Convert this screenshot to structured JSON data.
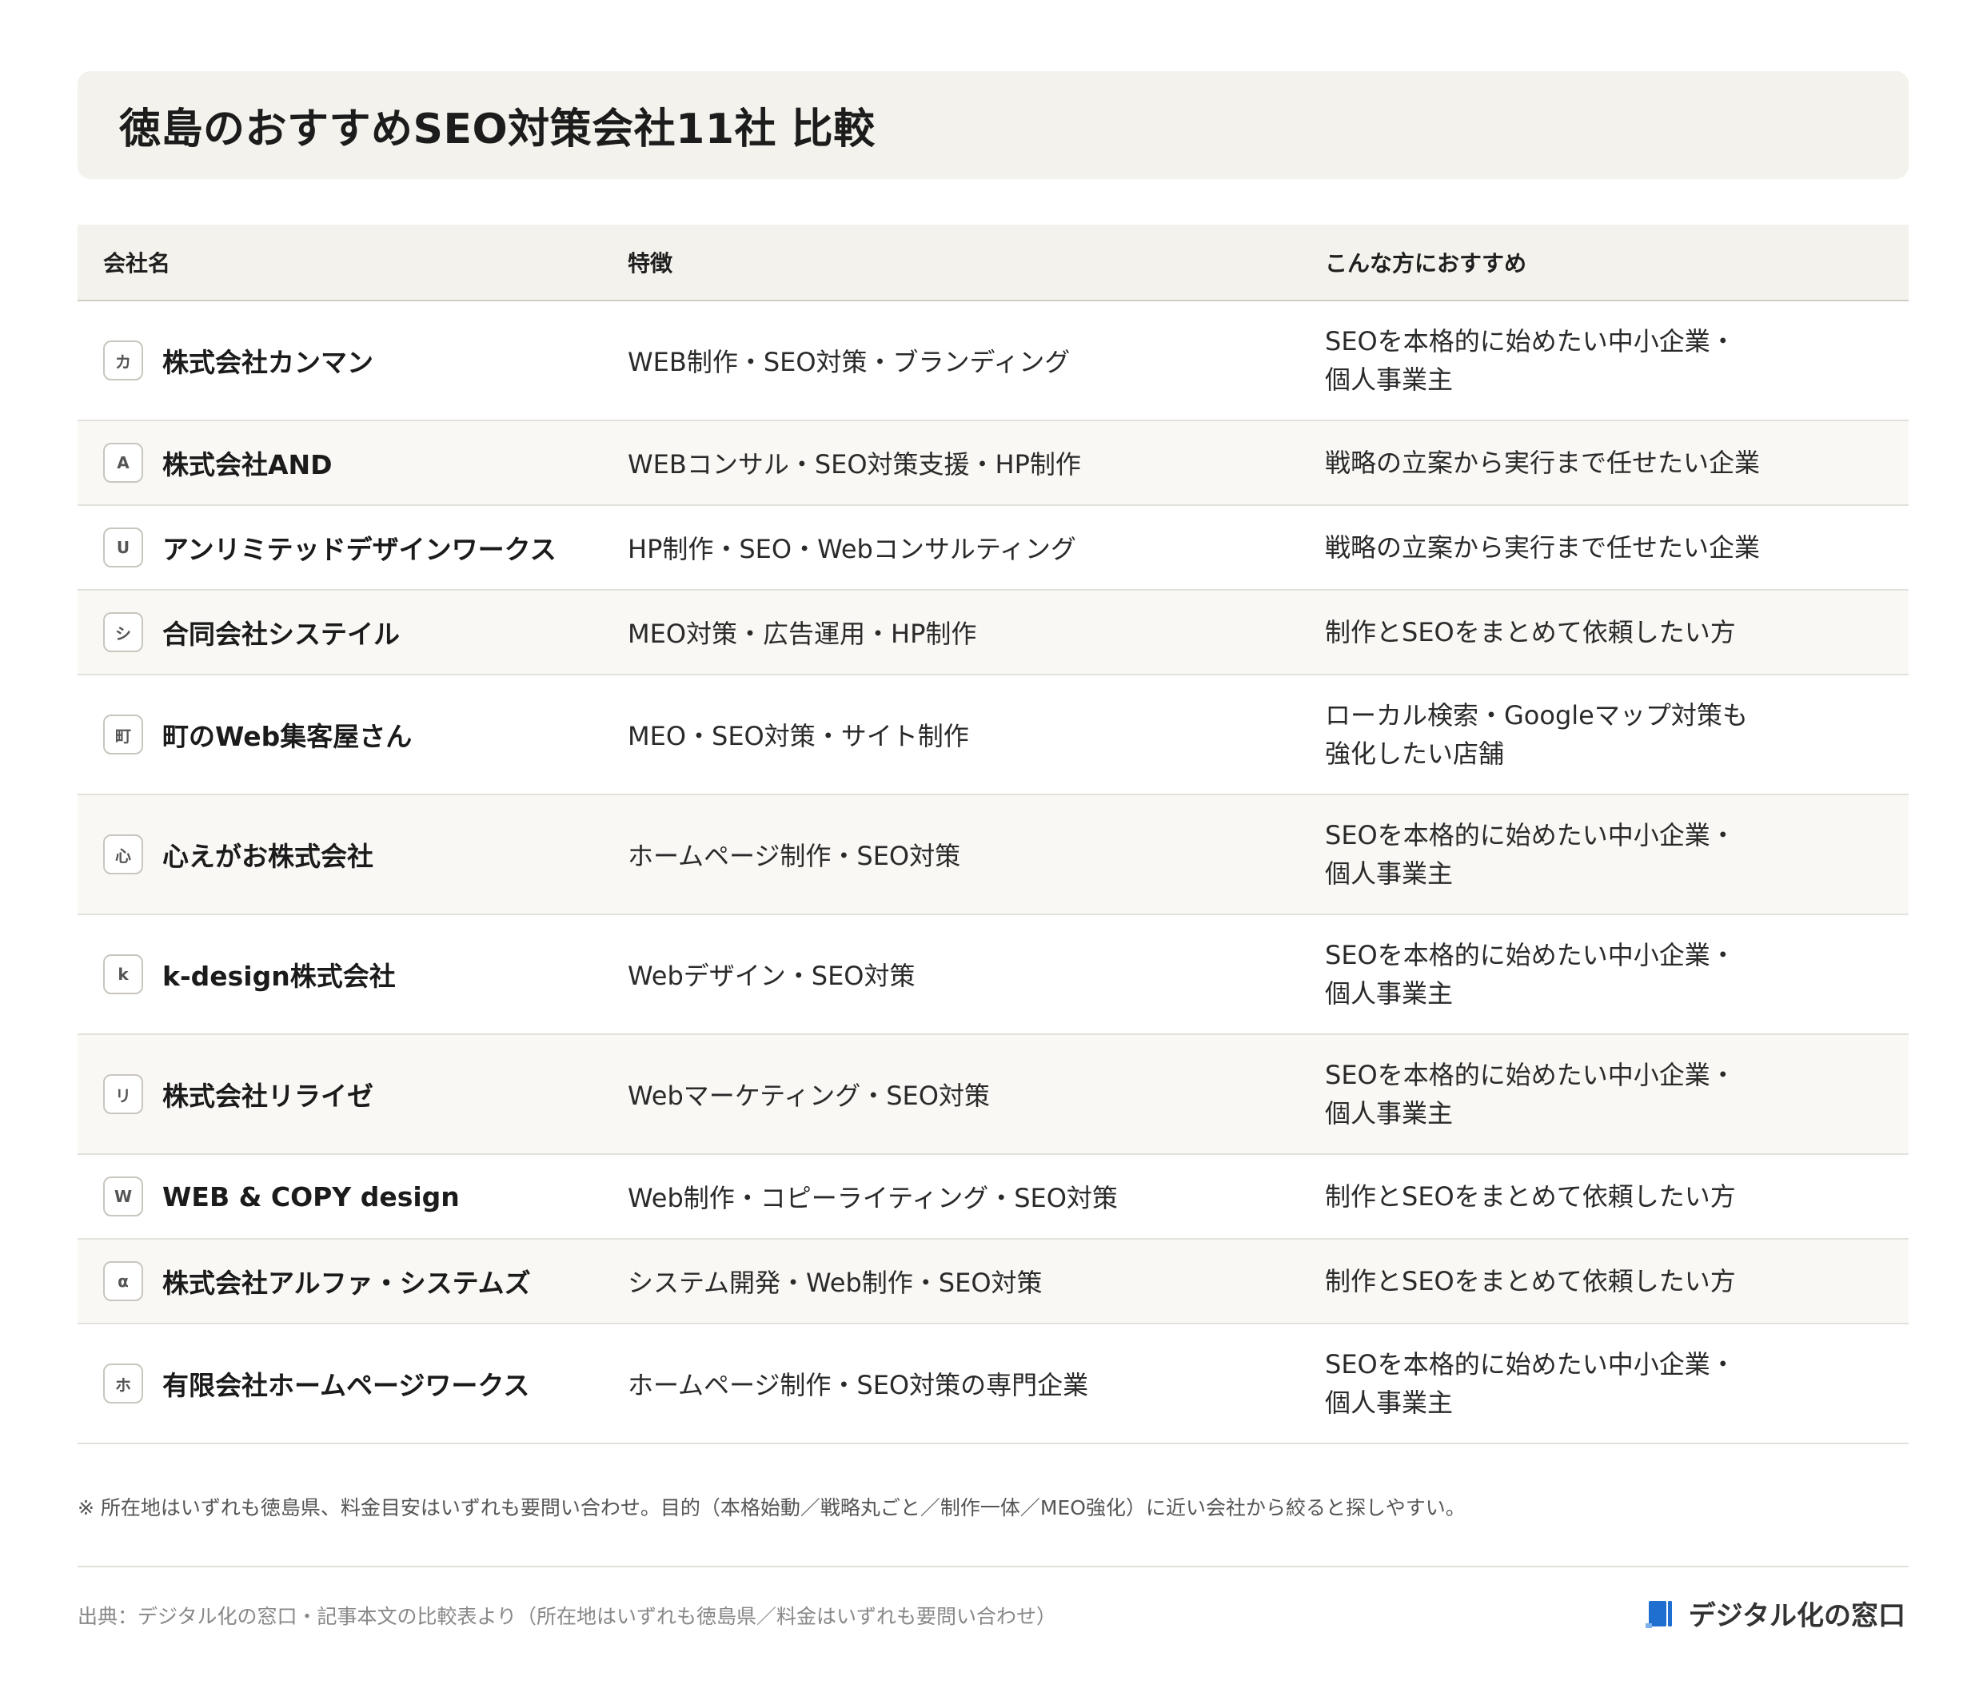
{
  "title": "徳島のおすすめSEO対策会社11社 比較",
  "table": {
    "headers": {
      "company": "会社名",
      "feature": "特徴",
      "recommended_for": "こんな方におすすめ"
    },
    "rows": [
      {
        "badge": "カ",
        "company": "株式会社カンマン",
        "feature": "WEB制作・SEO対策・ブランディング",
        "recommended_for": "SEOを本格的に始めたい中小企業・\n個人事業主"
      },
      {
        "badge": "A",
        "company": "株式会社AND",
        "feature": "WEBコンサル・SEO対策支援・HP制作",
        "recommended_for": "戦略の立案から実行まで任せたい企業"
      },
      {
        "badge": "U",
        "company": "アンリミテッドデザインワークス",
        "feature": "HP制作・SEO・Webコンサルティング",
        "recommended_for": "戦略の立案から実行まで任せたい企業"
      },
      {
        "badge": "シ",
        "company": "合同会社システイル",
        "feature": "MEO対策・広告運用・HP制作",
        "recommended_for": "制作とSEOをまとめて依頼したい方"
      },
      {
        "badge": "町",
        "company": "町のWeb集客屋さん",
        "feature": "MEO・SEO対策・サイト制作",
        "recommended_for": "ローカル検索・Googleマップ対策も\n強化したい店舗"
      },
      {
        "badge": "心",
        "company": "心えがお株式会社",
        "feature": "ホームページ制作・SEO対策",
        "recommended_for": "SEOを本格的に始めたい中小企業・\n個人事業主"
      },
      {
        "badge": "k",
        "company": "k-design株式会社",
        "feature": "Webデザイン・SEO対策",
        "recommended_for": "SEOを本格的に始めたい中小企業・\n個人事業主"
      },
      {
        "badge": "リ",
        "company": "株式会社リライゼ",
        "feature": "Webマーケティング・SEO対策",
        "recommended_for": "SEOを本格的に始めたい中小企業・\n個人事業主"
      },
      {
        "badge": "W",
        "company": "WEB & COPY design",
        "feature": "Web制作・コピーライティング・SEO対策",
        "recommended_for": "制作とSEOをまとめて依頼したい方"
      },
      {
        "badge": "α",
        "company": "株式会社アルファ・システムズ",
        "feature": "システム開発・Web制作・SEO対策",
        "recommended_for": "制作とSEOをまとめて依頼したい方"
      },
      {
        "badge": "ホ",
        "company": "有限会社ホームページワークス",
        "feature": "ホームページ制作・SEO対策の専門企業",
        "recommended_for": "SEOを本格的に始めたい中小企業・\n個人事業主"
      }
    ]
  },
  "note": "※ 所在地はいずれも徳島県、料金目安はいずれも要問い合わせ。目的（本格始動／戦略丸ごと／制作一体／MEO強化）に近い会社から絞ると探しやすい。",
  "source": "出典：デジタル化の窓口・記事本文の比較表より（所在地はいずれも徳島県／料金はいずれも要問い合わせ）",
  "logo": {
    "text": "デジタル化の窓口",
    "icon": "document-logo-icon",
    "color": "#1f6fd1"
  },
  "colors": {
    "header_bg": "#f4f2ec",
    "alt_row_bg": "#f9f8f5",
    "border": "#e3e1dc"
  }
}
